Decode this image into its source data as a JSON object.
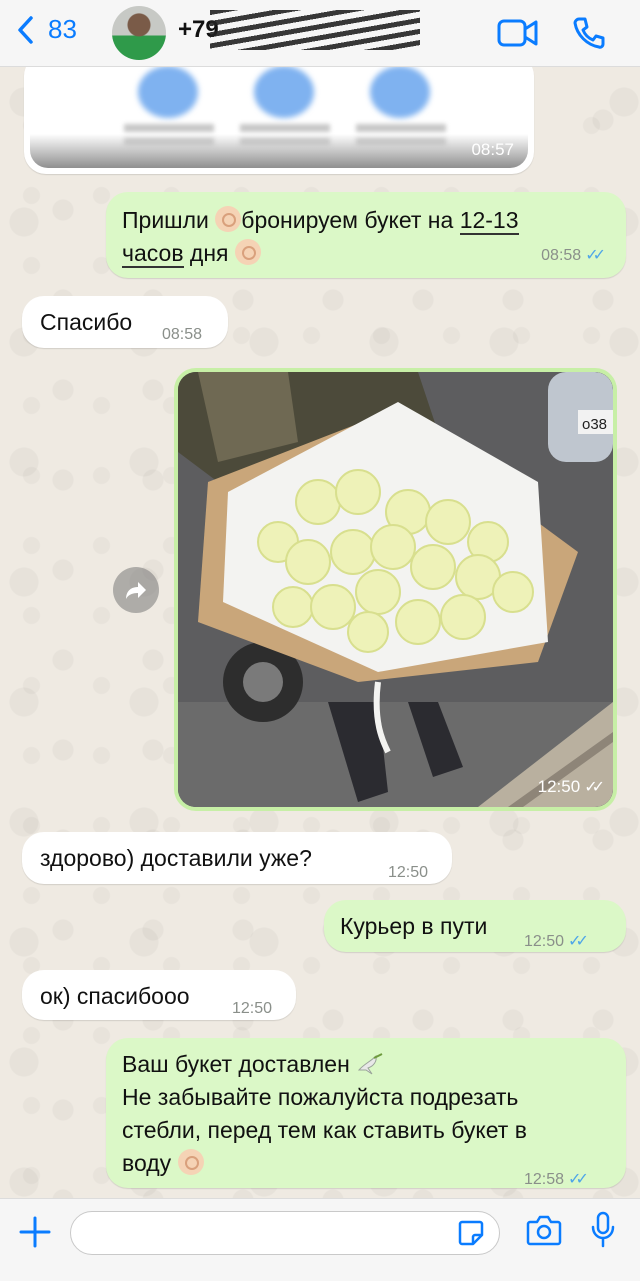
{
  "header": {
    "back_count": "83",
    "contact_phone": "+79"
  },
  "messages": [
    {
      "id": "m1",
      "text_parts": [
        "Пришли ",
        "бронируем букет на ",
        "12-13",
        "часов",
        " дня "
      ],
      "time": "08:58"
    },
    {
      "id": "m2",
      "text": "Спасибо",
      "time": "08:58"
    },
    {
      "id": "m3",
      "time": "12:50",
      "plate": "о38"
    },
    {
      "id": "m4",
      "text": "здорово) доставили уже?",
      "time": "12:50"
    },
    {
      "id": "m5",
      "text": "Курьер в пути",
      "time": "12:50"
    },
    {
      "id": "m6",
      "text": "ок) спасибооо",
      "time": "12:50"
    },
    {
      "id": "m7",
      "lines": [
        "Ваш букет доставлен ",
        "Не забывайте пожалуйста подрезать",
        "стебли, перед тем как ставить букет в",
        "воду "
      ],
      "time": "12:58"
    }
  ],
  "top_card": {
    "time": "08:57"
  },
  "composer": {
    "placeholder": ""
  },
  "colors": {
    "accent": "#0a7cff",
    "outgoing": "#dbf8c7",
    "incoming": "#ffffff",
    "read_ticks": "#4fa6e8"
  }
}
